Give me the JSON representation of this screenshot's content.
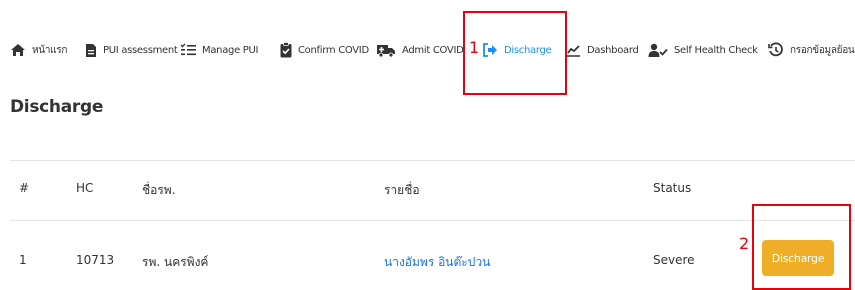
{
  "nav": {
    "items": [
      {
        "label": "หน้าแรก",
        "icon": "home-icon"
      },
      {
        "label": "PUI assessment",
        "icon": "document-icon"
      },
      {
        "label": "Manage PUI",
        "icon": "list-icon"
      },
      {
        "label": "Confirm COVID",
        "icon": "clipboard-check-icon"
      },
      {
        "label": "Admit COVID",
        "icon": "ambulance-icon"
      },
      {
        "label": "Discharge",
        "icon": "sign-out-icon",
        "active": true
      },
      {
        "label": "Dashboard",
        "icon": "chart-icon"
      },
      {
        "label": "Self Health Check",
        "icon": "user-check-icon"
      },
      {
        "label": "กรอกข้อมูลย้อนหลั",
        "icon": "history-icon"
      }
    ]
  },
  "page": {
    "title": "Discharge"
  },
  "table": {
    "headers": [
      "#",
      "HC",
      "ชื่อรพ.",
      "รายชื่อ",
      "Status"
    ],
    "rows": [
      {
        "num": "1",
        "hc": "10713",
        "hospital": "รพ. นครพิงค์",
        "name": "นางอัมพร อินต๊ะปวน",
        "status": "Severe",
        "action": "Discharge"
      }
    ]
  },
  "annotations": {
    "marker_1": "1",
    "marker_2": "2"
  },
  "colors": {
    "accent": "#1f8ef1",
    "button": "#f0ad28",
    "annotation": "#e8000b",
    "link": "#1a73e8"
  }
}
